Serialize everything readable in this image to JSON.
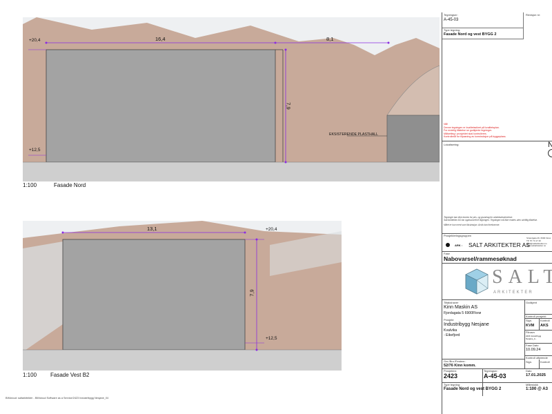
{
  "drawing_north": {
    "scale": "1:100",
    "title": "Fasade Nord",
    "dims": {
      "top_width": "16,4",
      "top_right": "8,1",
      "height": "7,9"
    },
    "levels": {
      "top": "+20,4",
      "bottom": "+12,5"
    },
    "existing_label": "EKSISTERENDE PLASTHALL"
  },
  "drawing_west": {
    "scale": "1:100",
    "title": "Fasade Vest B2",
    "dims": {
      "top_width": "13,1",
      "height": "7,9"
    },
    "levels": {
      "top": "+20,4",
      "bottom": "+12,5"
    }
  },
  "footer_note": "BIMcloud: saltarkitekter - BIMcloud Software as a Service/2423 Industribygg Nesjane_04",
  "titleblock": {
    "tegningsnr_label": "Tegningsnr:",
    "tegningsnr": "A-45-03",
    "revisjon_label": "Revisjon nr:",
    "typebetegnelse_label": "Type tegning:",
    "typebetegnelse": "Fasade Nord og vest BYGG 2",
    "red_note1": "NB!",
    "red_note2": "Denne tegningen er kvalitetssikret på kvalitetsplan.",
    "red_note3": "For endelig tillatelse se godkjente tegninger.",
    "red_note4": "Målsetting i prosjektet skal kontrolleres.",
    "red_note5": "Kontrollmål for tilpasning av konstruksjon på byggeplass.",
    "lokalisering_label": "Lokalisering:",
    "north_symbol": "N",
    "disclaimer1": "Tegninger kan ikke brukes for pris- og grunnlag for arbeidsbeskrivelser.",
    "disclaimer2": "Salt Arkitekter AS har opphavsrett til tegningen. Tegningen må ikke endres uten skriftlig tillatelse.",
    "disclaimer3": "Målet er kun ment som illustrasjon. Avvik kan forekomme.",
    "prosjekteringsgruppen_label": "Prosjekteringsgruppen",
    "ark_label": "ARK :",
    "ark_company": "SALT ARKITEKTER AS",
    "ark_addr1": "Strandgata 26, 6900 Florø",
    "ark_addr2": "Tlf: 57 74 17 40",
    "ark_addr3": "post@saltarkitekter.no",
    "ark_addr4": "www.saltarkitekter.no",
    "fase_label": "Fase",
    "fase": "Nabovarsel/rammesøknad",
    "logo_text": "SALT",
    "logo_sub": "ARKITEKTER",
    "tiltakshaver_label": "Tiltakshaver",
    "tiltakshaver": "Kinn Maskin AS",
    "tiltakshaver_addr": "Fjordagata 5 6900Florø",
    "prosjekt_label": "Prosjekt",
    "prosjekt": "Industribygg Nesjane",
    "prosjekt_sted1": "Kvalvika",
    "prosjekt_sted2": "- Eikefjord",
    "godkjent_label": "Godkjent",
    "kontroll_prosjekt_label": "Kontroll prosjekt:",
    "sign_label": "Sign.",
    "sign": "KVM",
    "kontroll_label": "Kontroll",
    "kontroll": "AKS",
    "filnavn_label": "Filnavn",
    "filnavn": "2423 Industribygg Nesjane_A...",
    "dato_label1": "Fase Dato",
    "dato1": "10.09.24",
    "kontroll_utforende_label": "Kontroll utførende",
    "gnr_label": "Gnr./Bnr./Festenr.:",
    "gnr": "52/76 Kinn komm.",
    "prosjektnr_label": "Prosjektnr:",
    "prosjektnr": "2423",
    "tegningsnr2_label": "Tegningsnr:",
    "tegningsnr2": "A-45-03",
    "dato_label": "Dato",
    "dato": "17.01.2025",
    "type_label2": "Type tegning:",
    "type2": "Fasade Nord og vest BYGG 2",
    "malestokk_label": "Målestokk",
    "malestokk": "1:100",
    "format": "@ A3"
  },
  "colors": {
    "terrain": "#c8aa9a",
    "building": "#a3a3a3",
    "ground": "#cfcfcf",
    "dimension": "#8a2be2"
  }
}
